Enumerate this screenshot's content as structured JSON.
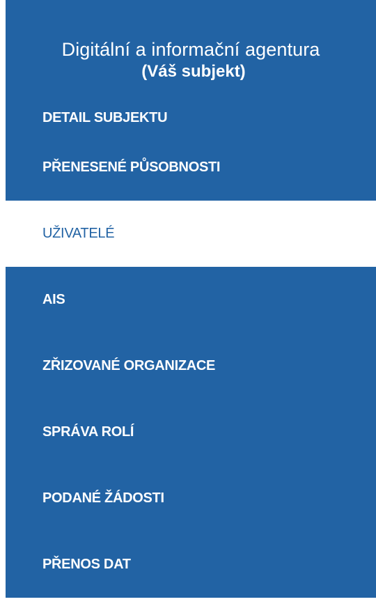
{
  "header": {
    "org_name": "Digitální a informační agentura",
    "org_sub": "(Váš subjekt)"
  },
  "menu": {
    "items": [
      {
        "label": "DETAIL SUBJEKTU"
      },
      {
        "label": "PŘENESENÉ PŮSOBNOSTI"
      },
      {
        "label": "UŽIVATELÉ",
        "active": true
      },
      {
        "label": "AIS"
      },
      {
        "label": "ZŘIZOVANÉ ORGANIZACE"
      },
      {
        "label": "SPRÁVA ROLÍ"
      },
      {
        "label": "PODANÉ ŽÁDOSTI"
      },
      {
        "label": "PŘENOS DAT"
      }
    ]
  },
  "colors": {
    "brand_blue": "#2263a4",
    "active_bg": "#ffffff",
    "text_on_blue": "#ffffff"
  }
}
